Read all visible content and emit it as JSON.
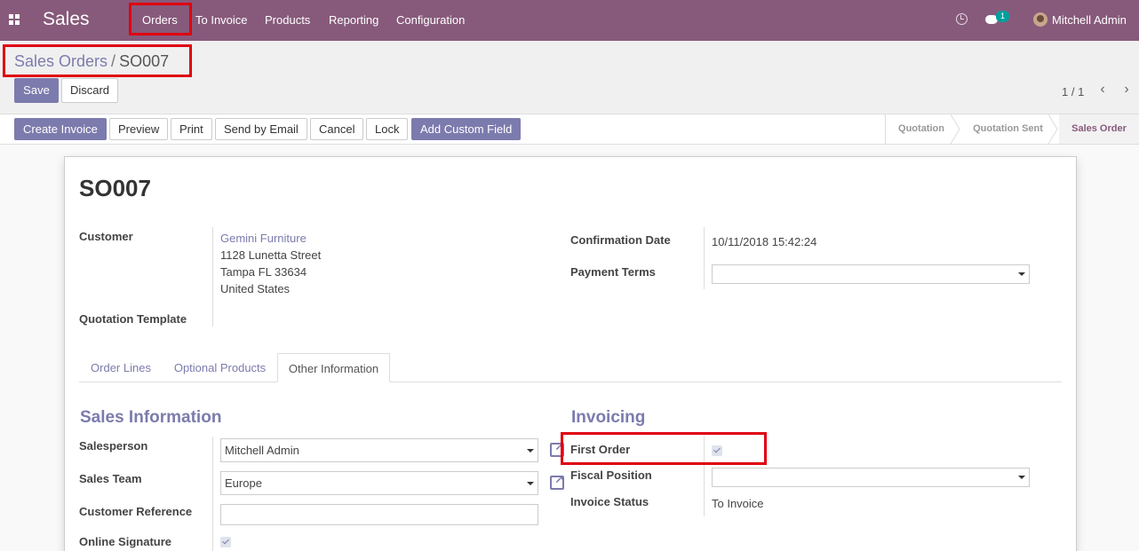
{
  "navbar": {
    "app_name": "Sales",
    "menu": [
      "Orders",
      "To Invoice",
      "Products",
      "Reporting",
      "Configuration"
    ],
    "chat_count": "1",
    "user": "Mitchell Admin",
    "bg_color": "#875a7b"
  },
  "breadcrumb": {
    "parent": "Sales Orders",
    "separator": "/",
    "current": "SO007"
  },
  "actions": {
    "save": "Save",
    "discard": "Discard"
  },
  "pager": {
    "value": "1 / 1"
  },
  "statusbar": {
    "buttons": [
      "Create Invoice",
      "Preview",
      "Print",
      "Send by Email",
      "Cancel",
      "Lock",
      "Add Custom Field"
    ],
    "stages": [
      "Quotation",
      "Quotation Sent",
      "Sales Order"
    ],
    "active_stage": "Sales Order"
  },
  "form": {
    "title": "SO007",
    "customer_label": "Customer",
    "customer_name": "Gemini Furniture",
    "customer_address": [
      "1128 Lunetta Street",
      "Tampa FL 33634",
      "United States"
    ],
    "quotation_template_label": "Quotation Template",
    "confirmation_date_label": "Confirmation Date",
    "confirmation_date": "10/11/2018 15:42:24",
    "payment_terms_label": "Payment Terms",
    "payment_terms": ""
  },
  "tabs": [
    "Order Lines",
    "Optional Products",
    "Other Information"
  ],
  "active_tab": "Other Information",
  "sales_info": {
    "title": "Sales Information",
    "salesperson_label": "Salesperson",
    "salesperson": "Mitchell Admin",
    "sales_team_label": "Sales Team",
    "sales_team": "Europe",
    "customer_ref_label": "Customer Reference",
    "customer_ref": "",
    "online_signature_label": "Online Signature",
    "online_signature": true
  },
  "invoicing": {
    "title": "Invoicing",
    "first_order_label": "First Order",
    "first_order": true,
    "fiscal_position_label": "Fiscal Position",
    "fiscal_position": "",
    "invoice_status_label": "Invoice Status",
    "invoice_status": "To Invoice"
  },
  "colors": {
    "accent": "#7c7bad",
    "highlight": "#e0000f"
  }
}
